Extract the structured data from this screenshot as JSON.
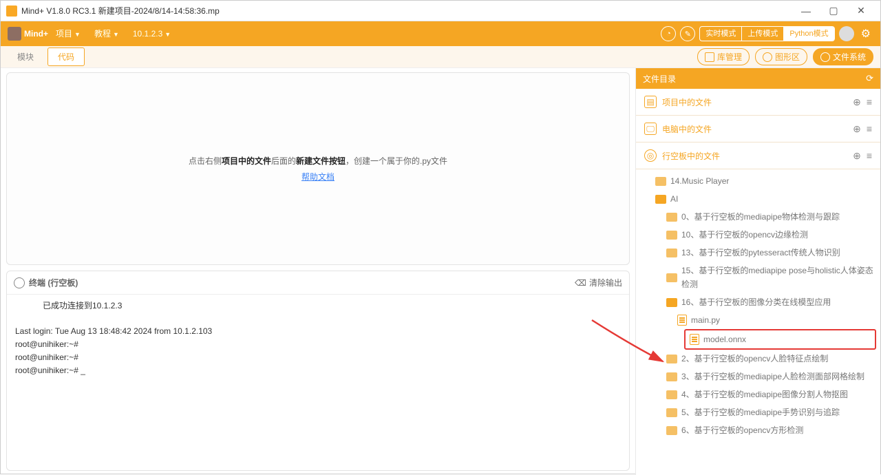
{
  "window": {
    "title": "Mind+ V1.8.0 RC3.1   新建项目-2024/8/14-14:58:36.mp"
  },
  "menubar": {
    "logo": "Mind+",
    "items": [
      "项目",
      "教程",
      "10.1.2.3"
    ],
    "modes": {
      "realtime": "实时模式",
      "upload": "上传模式",
      "python": "Python模式"
    }
  },
  "toolbar": {
    "tabs": {
      "module": "模块",
      "code": "代码"
    },
    "buttons": {
      "lib": "库管理",
      "graphics": "图形区",
      "filesys": "文件系统"
    }
  },
  "editor": {
    "prefix": "点击右侧",
    "bold1": "项目中的文件",
    "mid": "后面的",
    "bold2": "新建文件按钮",
    "suffix": "，创建一个属于你的.py文件",
    "help": "帮助文档"
  },
  "terminal": {
    "title": "终端 (行空板)",
    "clear": "清除输出",
    "connected": "已成功连接到10.1.2.3",
    "l1": "Last login: Tue Aug 13 18:48:42 2024 from 10.1.2.103",
    "l2": "root@unihiker:~#",
    "l3": "root@unihiker:~#",
    "l4": "root@unihiker:~# _"
  },
  "panel": {
    "title": "文件目录",
    "sections": {
      "project": "项目中的文件",
      "computer": "电脑中的文件",
      "board": "行空板中的文件"
    }
  },
  "tree": {
    "n1": "14.Music Player",
    "n2": "AI",
    "n3": "0、基于行空板的mediapipe物体检测与跟踪",
    "n4": "10、基于行空板的opencv边缘检测",
    "n5": "13、基于行空板的pytesseract传统人物识别",
    "n6": "15、基于行空板的mediapipe pose与holistic人体姿态检测",
    "n7": "16、基于行空板的图像分类在线模型应用",
    "f1": "main.py",
    "f2": "model.onnx",
    "n8": "2、基于行空板的opencv人脸特征点绘制",
    "n9": "3、基于行空板的mediapipe人脸检测面部网格绘制",
    "n10": "4、基于行空板的mediapipe图像分割人物抠图",
    "n11": "5、基于行空板的mediapipe手势识别与追踪",
    "n12": "6、基于行空板的opencv方形检测"
  }
}
